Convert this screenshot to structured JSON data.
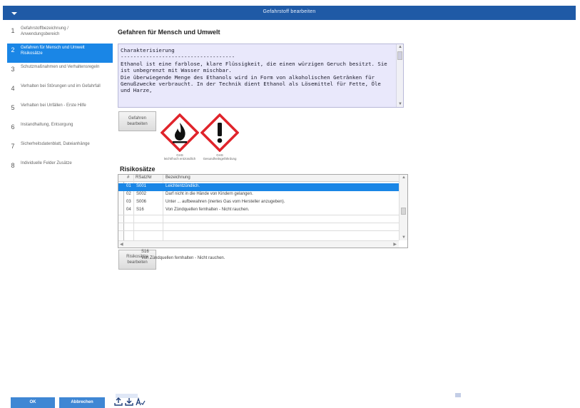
{
  "window": {
    "title": "Gefahrstoff bearbeiten"
  },
  "sidebar": {
    "items": [
      {
        "num": "1",
        "label": "Gefahrstoffbezeichnung / Anwendungsbereich",
        "active": false
      },
      {
        "num": "2",
        "label": "Gefahren für Mensch und Umwelt Risikosätze",
        "active": true
      },
      {
        "num": "3",
        "label": "Schutzmaßnahmen und Verhaltensregeln",
        "active": false
      },
      {
        "num": "4",
        "label": "Verhalten bei Störungen und im Gefahrfall",
        "active": false
      },
      {
        "num": "5",
        "label": "Verhalten bei Unfällen - Erste Hilfe",
        "active": false
      },
      {
        "num": "6",
        "label": "Instandhaltung, Entsorgung",
        "active": false
      },
      {
        "num": "7",
        "label": "Sicherheitsdatenblatt, Dateianhänge",
        "active": false
      },
      {
        "num": "8",
        "label": "Individuelle Felder Zusätze",
        "active": false
      }
    ]
  },
  "hazards": {
    "section_title": "Gefahren für Mensch und Umwelt",
    "text": "Charakterisierung\n------------------------------------\nEthanol ist eine farblose, klare Flüssigkeit, die einen würzigen Geruch besitzt. Sie ist unbegrenzt mit Wasser mischbar.\nDie überwiegende Menge des Ethanols wird in Form von alkoholischen Getränken für Genußzwecke verbraucht. In der Technik dient Ethanol als Lösemittel für Fette, Öle und Harze,",
    "edit_button": "Gefahren bearbeiten",
    "pictograms": [
      {
        "icon": "flame-icon",
        "code": "GHS",
        "caption": "leicht/hoch entzündlich"
      },
      {
        "icon": "exclamation-icon",
        "code": "GHS",
        "caption": "Gesundheitsgefährdung"
      }
    ]
  },
  "risk": {
    "section_title": "Risikosätze",
    "columns": [
      "#",
      "RSatzNr",
      "Bezeichnung"
    ],
    "rows": [
      {
        "idx": "01",
        "code": "S001",
        "text": "Leichtentzündlich.",
        "selected": true
      },
      {
        "idx": "02",
        "code": "S002",
        "text": "Darf nicht in die Hände von Kindern gelangen.",
        "selected": false
      },
      {
        "idx": "03",
        "code": "S006",
        "text": "Unter ... aufbewahren (inertes Gas vom Hersteller anzugeben).",
        "selected": false
      },
      {
        "idx": "04",
        "code": "S16",
        "text": "Von Zündquellen fernhalten - Nicht rauchen.",
        "selected": false
      }
    ],
    "edit_button": "Risikosätze bearbeiten",
    "selected_code": "S16",
    "selected_text": "Von Zündquellen fernhalten - Nicht rauchen."
  },
  "footer": {
    "ok_label": "OK",
    "cancel_label": "Abbrechen"
  },
  "colors": {
    "titlebar": "#1f5aa6",
    "accent": "#1a86e6",
    "pictogram_red": "#e0242b"
  }
}
